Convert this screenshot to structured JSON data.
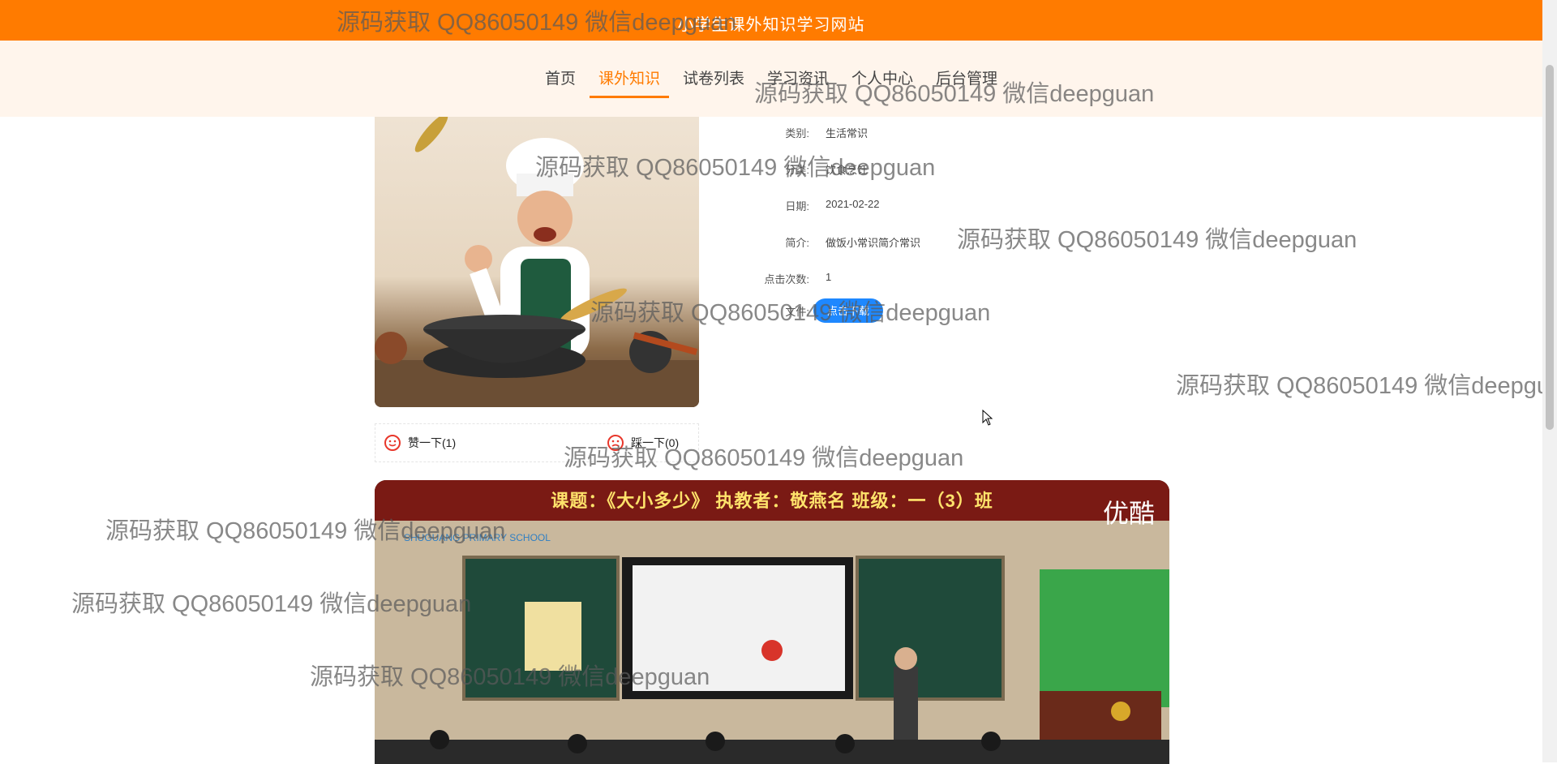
{
  "header": {
    "site_title": "小学生课外知识学习网站"
  },
  "nav": {
    "items": [
      {
        "label": "首页",
        "active": false
      },
      {
        "label": "课外知识",
        "active": true
      },
      {
        "label": "试卷列表",
        "active": false
      },
      {
        "label": "学习资讯",
        "active": false
      },
      {
        "label": "个人中心",
        "active": false
      },
      {
        "label": "后台管理",
        "active": false
      }
    ]
  },
  "detail": {
    "category_label": "类别:",
    "category_value": "生活常识",
    "type_label": "分类:",
    "type_value": "饮食烹饪",
    "date_label": "日期:",
    "date_value": "2021-02-22",
    "intro_label": "简介:",
    "intro_value": "做饭小常识简介常识",
    "clicks_label": "点击次数:",
    "clicks_value": "1",
    "file_label": "文件:",
    "download_label": "点击下载"
  },
  "votes": {
    "like_label": "赞一下(1)",
    "dislike_label": "踩一下(0)"
  },
  "video": {
    "banner_text": "课题：《大小多少》 执教者：敬燕名 班级：一（3）班",
    "school_text": "SHUGUANG PRIMARY SCHOOL",
    "brand_text": "优酷"
  },
  "watermark": {
    "text": "源码获取 QQ86050149 微信deepguan"
  },
  "colors": {
    "primary": "#ff7b00",
    "nav_bg": "#fff5ec",
    "button_blue": "#1e88ff"
  }
}
